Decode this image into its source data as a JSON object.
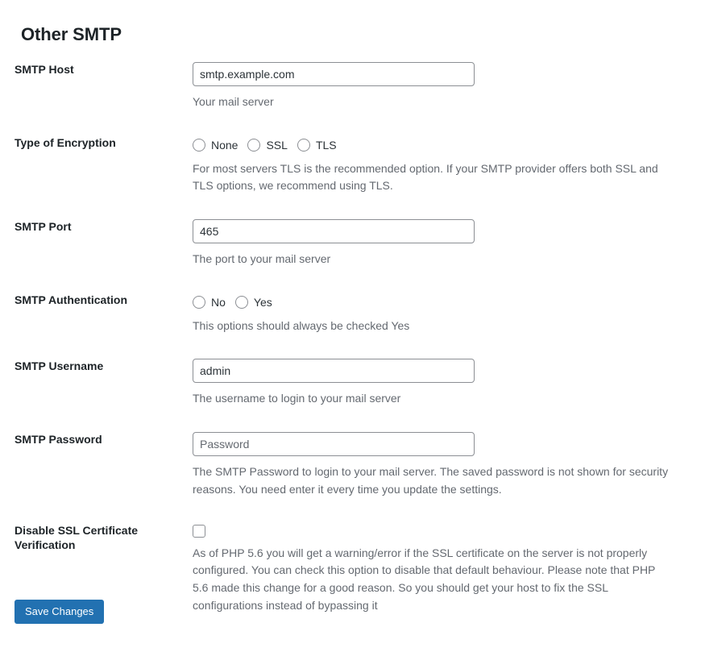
{
  "page": {
    "title": "Other SMTP"
  },
  "fields": [
    {
      "id": "smtp-host",
      "label": "SMTP Host",
      "type": "text",
      "value": "smtp.example.com",
      "placeholder": "smtp.example.com",
      "description": "Your mail server"
    },
    {
      "id": "type-of-encryption",
      "label": "Type of Encryption",
      "type": "radio",
      "options": [
        {
          "label": "None",
          "checked": false
        },
        {
          "label": "SSL",
          "checked": false
        },
        {
          "label": "TLS",
          "checked": false
        }
      ],
      "description": "For most servers TLS is the recommended option. If your SMTP provider offers both SSL and TLS options, we recommend using TLS."
    },
    {
      "id": "smtp-port",
      "label": "SMTP Port",
      "type": "text",
      "value": "465",
      "placeholder": "465",
      "description": "The port to your mail server"
    },
    {
      "id": "smtp-authentication",
      "label": "SMTP Authentication",
      "type": "radio",
      "options": [
        {
          "label": "No",
          "checked": false
        },
        {
          "label": "Yes",
          "checked": false
        }
      ],
      "description": "This options should always be checked Yes"
    },
    {
      "id": "smtp-username",
      "label": "SMTP Username",
      "type": "text",
      "value": "admin",
      "placeholder": "admin",
      "description": "The username to login to your mail server"
    },
    {
      "id": "smtp-password",
      "label": "SMTP Password",
      "type": "password",
      "value": "",
      "placeholder": "Password",
      "description": "The SMTP Password to login to your mail server. The saved password is not shown for security reasons. You need enter it every time you update the settings."
    },
    {
      "id": "disable-ssl-certificate-verification",
      "label": "Disable SSL Certificate Verification",
      "type": "checkbox",
      "checked": false,
      "description": "As of PHP 5.6 you will get a warning/error if the SSL certificate on the server is not properly configured. You can check this option to disable that default behaviour. Please note that PHP 5.6 made this change for a good reason. So you should get your host to fix the SSL configurations instead of bypassing it"
    }
  ],
  "submit": {
    "label": "Save Changes"
  },
  "colors": {
    "primary_button": "#2271b1",
    "text": "#1d2327",
    "description_text": "#646970",
    "input_border": "#8c8f94"
  }
}
